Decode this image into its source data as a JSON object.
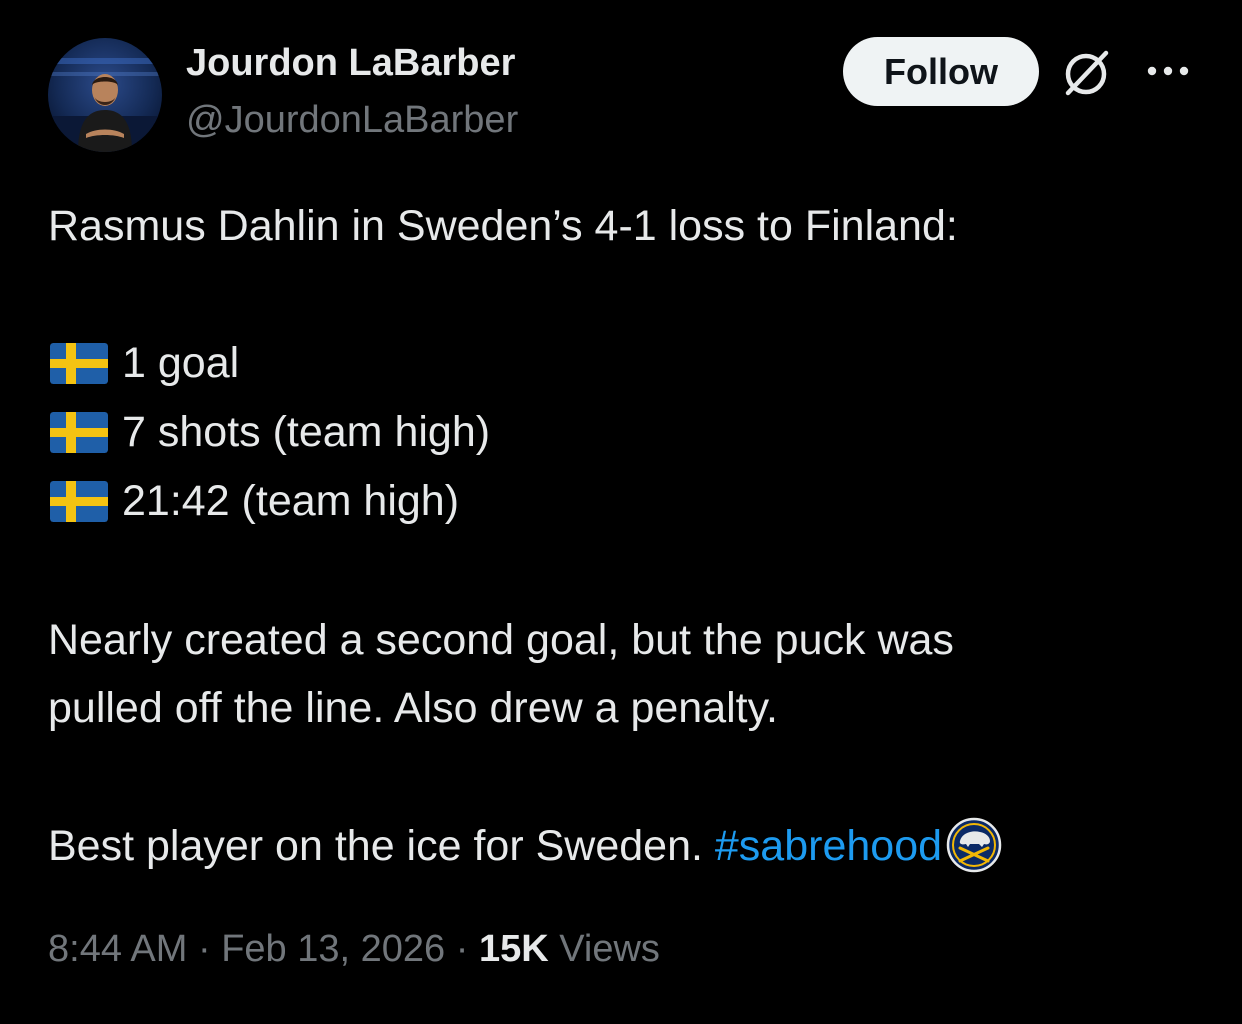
{
  "author": {
    "name": "Jourdon LaBarber",
    "handle": "@JourdonLaBarber"
  },
  "actions": {
    "follow_label": "Follow",
    "grok_icon": "grok-icon",
    "more_icon": "more-horizontal-icon"
  },
  "tweet": {
    "intro": "Rasmus Dahlin in Sweden’s 4-1 loss to Finland:",
    "stats": [
      {
        "icon": "sweden-flag-icon",
        "text": "1 goal"
      },
      {
        "icon": "sweden-flag-icon",
        "text": "7 shots (team high)"
      },
      {
        "icon": "sweden-flag-icon",
        "text": "21:42 (team high)"
      }
    ],
    "paragraph_line1": "Nearly created a second goal, but the puck was",
    "paragraph_line2": "pulled off the line. Also drew a penalty.",
    "closing_text": "Best player on the ice for Sweden. ",
    "hashtag": "#sabrehood",
    "hashtag_icon": "buffalo-sabres-logo-icon"
  },
  "meta": {
    "time": "8:44 AM",
    "separator": " · ",
    "date": "Feb 13, 2026",
    "views_count": "15K",
    "views_label": "Views"
  },
  "colors": {
    "background": "#000000",
    "text_primary": "#e7e9ea",
    "text_secondary": "#71767b",
    "link": "#1d9bf0",
    "follow_bg": "#eff3f4",
    "flag_blue": "#1f5fa8",
    "flag_yellow": "#f4c312"
  }
}
